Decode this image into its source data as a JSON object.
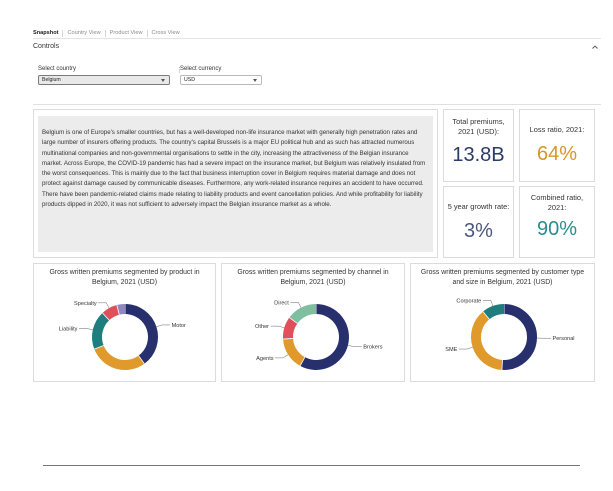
{
  "tabs": [
    "Snapshot",
    "Country View",
    "Product View",
    "Cross View"
  ],
  "active_tab": "Snapshot",
  "controls": {
    "title": "Controls",
    "country_label": "Select country",
    "country_value": "Belgium",
    "currency_label": "Select currency",
    "currency_value": "USD"
  },
  "description": "Belgium is one of Europe's smaller countries, but has a well-developed non-life insurance market with generally high penetration rates and large number of insurers offering products. The country's capital Brussels is a major EU political hub and as such has attracted numerous multinational companies and non-governmental organisations to settle in the city, increasing the attractiveness of the Belgian insurance market. Across Europe, the COVID-19 pandemic has had a severe impact on the insurance market, but Belgium was relatively insulated from the worst consequences. This is mainly due to the fact that business interruption cover in Belgium requires material damage and does not protect against damage caused by communicable diseases. Furthermore, any work-related insurance requires an accident to have occurred. There have been pandemic-related claims made relating to liability products and event cancellation policies. And while profitability for liability products dipped in 2020, it was not sufficient to adversely impact the Belgian insurance market as a whole.",
  "kpis": {
    "total_premiums": {
      "label": "Total premiums, 2021 (USD):",
      "value": "13.8B",
      "color": "#2b3a67"
    },
    "loss_ratio": {
      "label": "Loss ratio, 2021:",
      "value": "64%",
      "color": "#d6962a"
    },
    "growth_rate": {
      "label": "5 year growth rate:",
      "value": "3%",
      "color": "#4a5680"
    },
    "combined_ratio": {
      "label": "Combined ratio, 2021:",
      "value": "90%",
      "color": "#2a8d8d"
    }
  },
  "charts": {
    "product": {
      "title_line1": "Gross written premiums segmented by product in",
      "title_line2": "Belgium, 2021 (USD)",
      "slices": [
        {
          "label": "Motor",
          "value": 40,
          "color": "#27306d"
        },
        {
          "label": "",
          "value": 29,
          "color": "#e09a2c"
        },
        {
          "label": "Liability",
          "value": 19,
          "color": "#1f7d7d"
        },
        {
          "label": "Specialty",
          "value": 8,
          "color": "#e0505a"
        },
        {
          "label": "",
          "value": 4,
          "color": "#8e87c0"
        }
      ]
    },
    "channel": {
      "title_line1": "Gross written premiums segmented by channel in",
      "title_line2": "Belgium, 2021 (USD)",
      "slices": [
        {
          "label": "Brokers",
          "value": 58,
          "color": "#27306d"
        },
        {
          "label": "Agents",
          "value": 16,
          "color": "#e09a2c"
        },
        {
          "label": "Other",
          "value": 11,
          "color": "#e0505a"
        },
        {
          "label": "Direct",
          "value": 15,
          "color": "#7fbf9f"
        }
      ]
    },
    "customer": {
      "title_line1": "Gross written premiums segmented by customer type",
      "title_line2": "and size in  Belgium, 2021 (USD)",
      "slices": [
        {
          "label": "Personal",
          "value": 51,
          "color": "#27306d"
        },
        {
          "label": "SME",
          "value": 38,
          "color": "#e09a2c"
        },
        {
          "label": "Corporate",
          "value": 11,
          "color": "#1f7d7d"
        }
      ]
    }
  }
}
